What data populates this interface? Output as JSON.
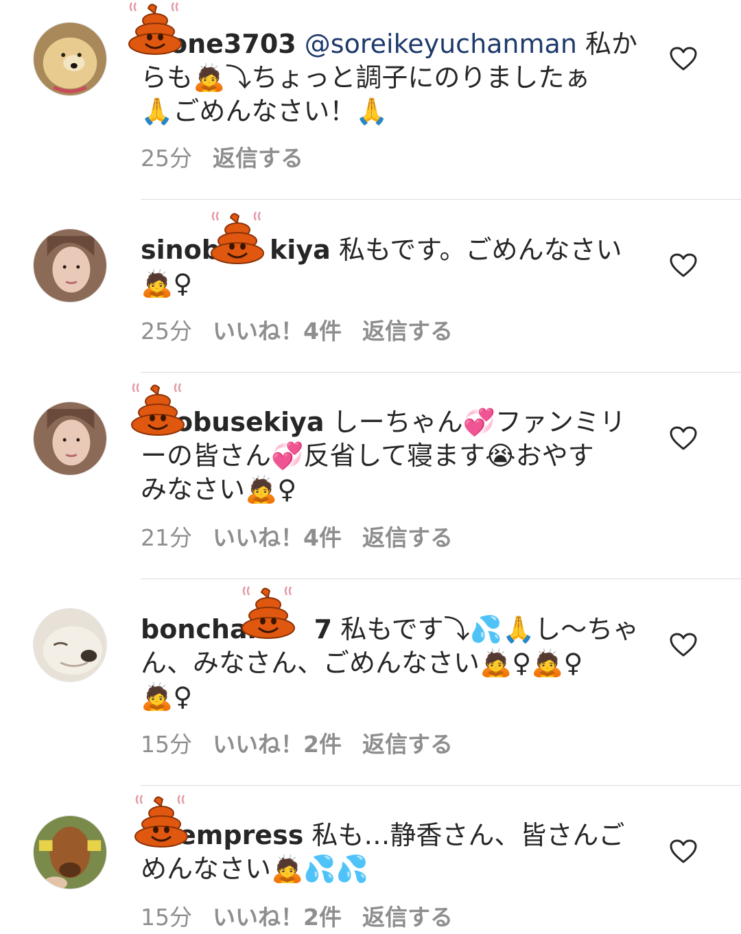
{
  "comments": [
    {
      "username": "one3703",
      "mention": "@soreikeyuchanman",
      "body_lines": [
        "私か",
        "らも🙇⤵ちょっと調子にのりましたぁ",
        "🙏ごめんなさい！🙏"
      ],
      "time": "25分",
      "likes": "",
      "reply": "返信する"
    },
    {
      "username_start": "sinob",
      "username_end": "kiya",
      "body_lines": [
        "私もです。ごめんなさい",
        "🙇♀"
      ],
      "time": "25分",
      "likes": "いいね！4件",
      "reply": "返信する"
    },
    {
      "username": "obusekiya",
      "body_lines": [
        "しーちゃん💞ファンミリ",
        "ーの皆さん💞反省して寝ます😭おやす",
        "みなさい🙇♀"
      ],
      "time": "21分",
      "likes": "いいね！4件",
      "reply": "返信する"
    },
    {
      "username_start": "bonchan",
      "username_end": "7",
      "body_lines": [
        "私もです⤵💦🙏し〜ちゃ",
        "ん、みなさん、ごめんなさい🙇♀🙇♀",
        "🙇♀"
      ],
      "time": "15分",
      "likes": "いいね！2件",
      "reply": "返信する"
    },
    {
      "username": "empress",
      "body_lines": [
        "私も…静香さん、皆さんご",
        "めんなさい🙇💦💦"
      ],
      "time": "15分",
      "likes": "いいね！2件",
      "reply": "返信する"
    }
  ]
}
